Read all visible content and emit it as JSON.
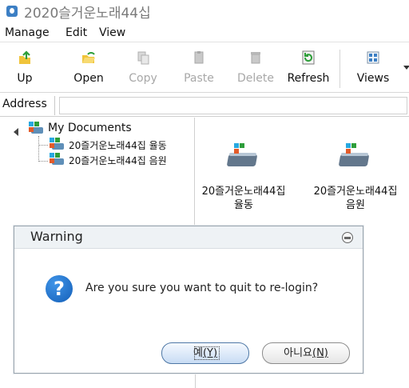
{
  "window": {
    "title": "2020슬거운노래44십"
  },
  "menu": {
    "items": [
      "Manage",
      "Edit",
      "View"
    ]
  },
  "toolbar": {
    "buttons": [
      {
        "label": "Up",
        "icon": "up-folder-icon",
        "enabled": true
      },
      {
        "label": "Open",
        "icon": "open-folder-icon",
        "enabled": true
      },
      {
        "label": "Copy",
        "icon": "copy-icon",
        "enabled": false
      },
      {
        "label": "Paste",
        "icon": "paste-icon",
        "enabled": false
      },
      {
        "label": "Delete",
        "icon": "delete-icon",
        "enabled": false
      },
      {
        "label": "Refresh",
        "icon": "refresh-icon",
        "enabled": true
      },
      {
        "label": "Views",
        "icon": "views-icon",
        "enabled": true
      }
    ]
  },
  "address": {
    "label": "Address",
    "value": ""
  },
  "tree": {
    "root": {
      "label": "My Documents",
      "icon": "network-drive-icon"
    },
    "children": [
      {
        "label": "20즐거운노래44집 율동",
        "icon": "network-drive-icon"
      },
      {
        "label": "20즐거운노래44집 음원",
        "icon": "network-drive-icon"
      }
    ]
  },
  "content": {
    "items": [
      {
        "line1": "20즐거운노래44집",
        "line2": "율동",
        "icon": "network-drive-icon"
      },
      {
        "line1": "20즐거운노래44집",
        "line2": "음원",
        "icon": "network-drive-icon"
      }
    ]
  },
  "dialog": {
    "title": "Warning",
    "message": "Are you sure you want to quit to re-login?",
    "icon": "question-icon",
    "yes": {
      "text": "예",
      "key": "(Y)"
    },
    "no": {
      "text": "아니요",
      "key": "(N)"
    }
  },
  "colors": {
    "accent": "#145fb8",
    "windows_blue": "#28a8e0",
    "windows_green": "#2e9e3a",
    "windows_orange": "#e35b2a",
    "disabled_text": "#a8a8a8"
  }
}
